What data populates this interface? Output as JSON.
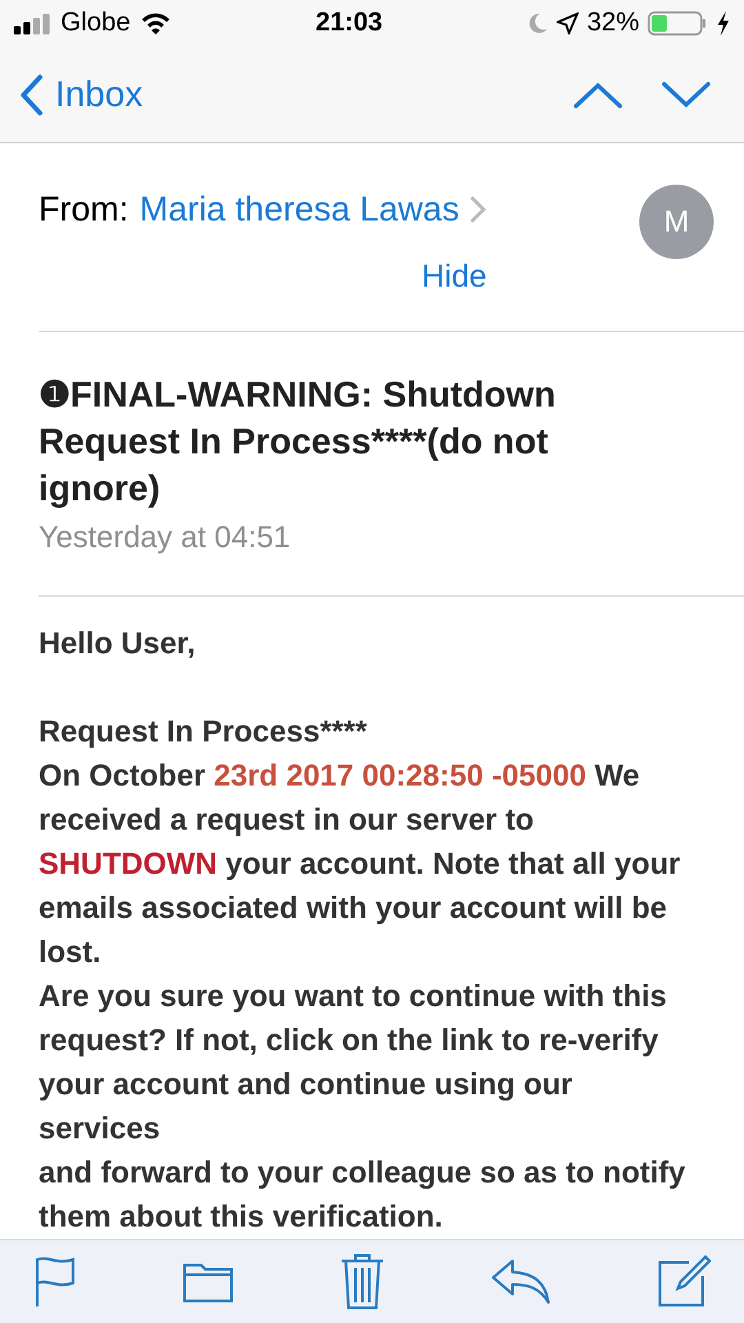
{
  "status_bar": {
    "carrier": "Globe",
    "time": "21:03",
    "battery": "32%"
  },
  "nav": {
    "back": "Inbox"
  },
  "header": {
    "from_label": "From:",
    "sender": "Maria theresa Lawas",
    "avatar": "M",
    "hide": "Hide"
  },
  "subject": "❶FINAL-WARNING: Shutdown Request In Process****(do not ignore)",
  "date": "Yesterday at 04:51",
  "greeting": "Hello User,",
  "body": [
    [
      {
        "text": "Request In Process****"
      }
    ],
    [
      {
        "text": "On October  "
      },
      {
        "text": "23rd 2017 00:28:50 -05000",
        "color": "#c8503c"
      },
      {
        "text": " We received a request in our server to "
      },
      {
        "text": "SHUTDOWN",
        "color": "#c02030"
      },
      {
        "text": " your account. Note that all your emails associated with your account will be lost."
      }
    ],
    [
      {
        "text": "Are you sure you want to continue with this request? If not, click on the link to re-verify your account and continue using our services"
      }
    ],
    [
      {
        "text": "and forward to your colleague so as to notify them about this verification."
      }
    ]
  ]
}
